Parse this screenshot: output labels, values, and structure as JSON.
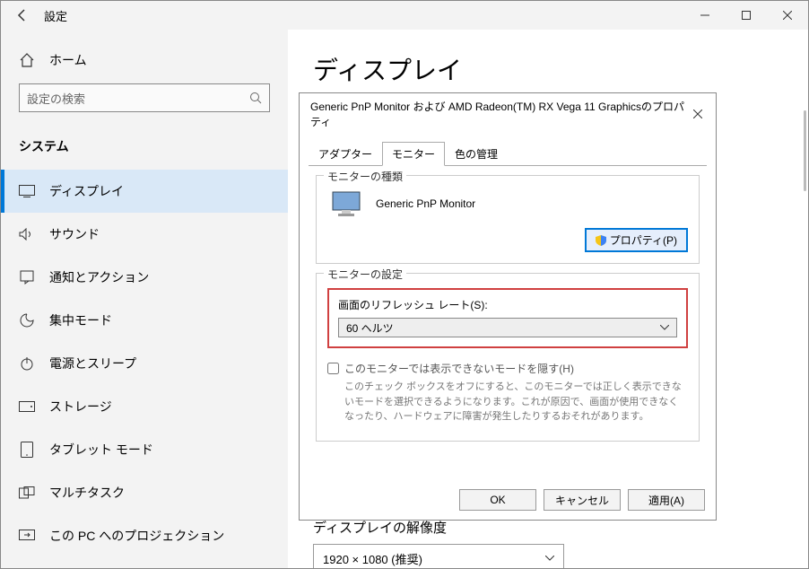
{
  "titlebar": {
    "title": "設定"
  },
  "sidebar": {
    "home": "ホーム",
    "search_placeholder": "設定の検索",
    "category": "システム",
    "items": [
      {
        "label": "ディスプレイ"
      },
      {
        "label": "サウンド"
      },
      {
        "label": "通知とアクション"
      },
      {
        "label": "集中モード"
      },
      {
        "label": "電源とスリープ"
      },
      {
        "label": "ストレージ"
      },
      {
        "label": "タブレット モード"
      },
      {
        "label": "マルチタスク"
      },
      {
        "label": "この PC へのプロジェクション"
      }
    ]
  },
  "main": {
    "heading": "ディスプレイ",
    "resolution_section": "ディスプレイの解像度",
    "resolution_value": "1920 × 1080 (推奨)"
  },
  "dialog": {
    "title": "Generic PnP Monitor および AMD Radeon(TM) RX Vega 11 Graphicsのプロパティ",
    "tabs": {
      "adapter": "アダプター",
      "monitor": "モニター",
      "color": "色の管理"
    },
    "group_type": "モニターの種類",
    "monitor_name": "Generic PnP Monitor",
    "properties_btn": "プロパティ(P)",
    "group_settings": "モニターの設定",
    "rate_label": "画面のリフレッシュ レート(S):",
    "rate_value": "60 ヘルツ",
    "hide_label": "このモニターでは表示できないモードを隠す(H)",
    "hide_desc": "このチェック ボックスをオフにすると、このモニターでは正しく表示できないモードを選択できるようになります。これが原因で、画面が使用できなくなったり、ハードウェアに障害が発生したりするおそれがあります。",
    "buttons": {
      "ok": "OK",
      "cancel": "キャンセル",
      "apply": "適用(A)"
    }
  }
}
